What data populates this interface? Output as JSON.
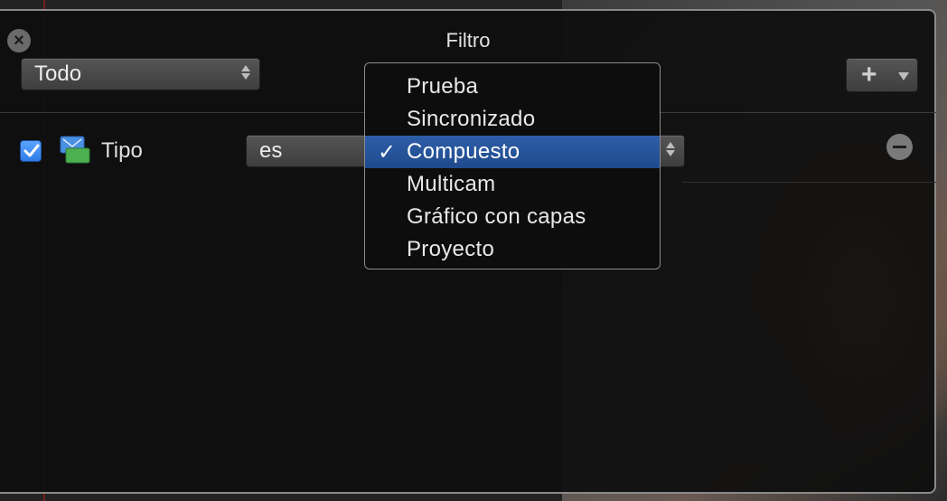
{
  "window": {
    "title": "Filtro"
  },
  "header": {
    "scope_select": {
      "value": "Todo"
    }
  },
  "filter_rule": {
    "enabled": true,
    "field_label": "Tipo",
    "operator": "es",
    "value": "Compuesto"
  },
  "dropdown": {
    "selected_index": 2,
    "check_glyph": "✓",
    "options": [
      "Prueba",
      "Sincronizado",
      "Compuesto",
      "Multicam",
      "Gráfico con capas",
      "Proyecto"
    ]
  },
  "icons": {
    "close": "close-icon",
    "add": "plus-icon",
    "add_menu": "chevron-down-icon",
    "remove": "minus-icon",
    "type": "compound-clip-icon"
  },
  "colors": {
    "accent": "#2f6fd6",
    "selection": "#1f4a8c"
  }
}
